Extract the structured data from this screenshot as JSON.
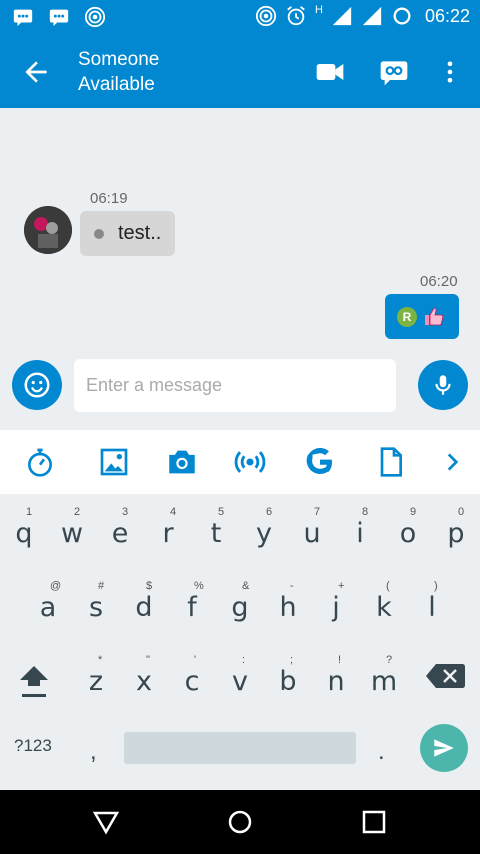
{
  "status_bar": {
    "time": "06:22",
    "network_label": "H"
  },
  "header": {
    "contact_name": "Someone",
    "contact_status": "Available"
  },
  "messages": [
    {
      "direction": "incoming",
      "timestamp": "06:19",
      "text": "test.."
    },
    {
      "direction": "outgoing",
      "timestamp": "06:20",
      "badge": "R",
      "sticker": "thumbs-up"
    }
  ],
  "composer": {
    "placeholder": "Enter a message"
  },
  "keyboard": {
    "row1": [
      {
        "k": "q",
        "h": "1"
      },
      {
        "k": "w",
        "h": "2"
      },
      {
        "k": "e",
        "h": "3"
      },
      {
        "k": "r",
        "h": "4"
      },
      {
        "k": "t",
        "h": "5"
      },
      {
        "k": "y",
        "h": "6"
      },
      {
        "k": "u",
        "h": "7"
      },
      {
        "k": "i",
        "h": "8"
      },
      {
        "k": "o",
        "h": "9"
      },
      {
        "k": "p",
        "h": "0"
      }
    ],
    "row2": [
      {
        "k": "a",
        "h": "@"
      },
      {
        "k": "s",
        "h": "#"
      },
      {
        "k": "d",
        "h": "$"
      },
      {
        "k": "f",
        "h": "%"
      },
      {
        "k": "g",
        "h": "&"
      },
      {
        "k": "h",
        "h": "-"
      },
      {
        "k": "j",
        "h": "+"
      },
      {
        "k": "k",
        "h": "("
      },
      {
        "k": "l",
        "h": ")"
      }
    ],
    "row3": [
      {
        "k": "z",
        "h": "*"
      },
      {
        "k": "x",
        "h": "\""
      },
      {
        "k": "c",
        "h": "'"
      },
      {
        "k": "v",
        "h": ":"
      },
      {
        "k": "b",
        "h": ";"
      },
      {
        "k": "n",
        "h": "!"
      },
      {
        "k": "m",
        "h": "?"
      }
    ],
    "symbols_label": "?123",
    "comma": ",",
    "period": "."
  },
  "colors": {
    "primary": "#0288D1",
    "keyboard_bg": "#ECEFF1",
    "enter": "#4DB6AC",
    "incoming_bubble": "#D6D6D6"
  }
}
